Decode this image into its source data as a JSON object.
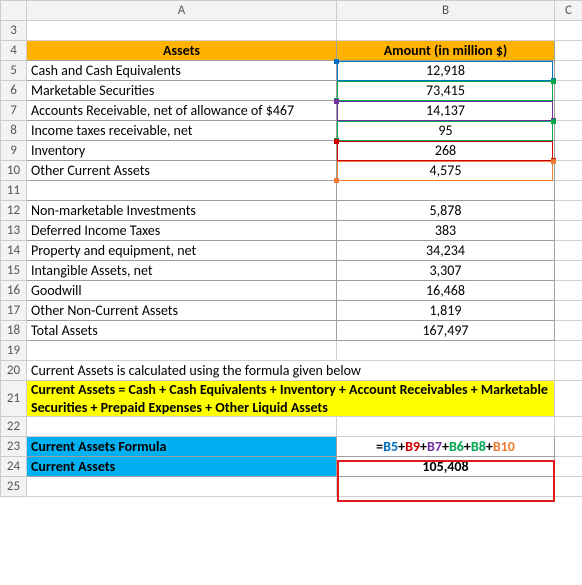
{
  "columns": {
    "A": "A",
    "B": "B",
    "C": "C"
  },
  "rows": [
    "3",
    "4",
    "5",
    "6",
    "7",
    "8",
    "9",
    "10",
    "11",
    "12",
    "13",
    "14",
    "15",
    "16",
    "17",
    "18",
    "19",
    "20",
    "21",
    "22",
    "23",
    "24",
    "25"
  ],
  "header": {
    "assets": "Assets",
    "amount": "Amount (in million $)"
  },
  "current_assets_rows": [
    {
      "label": "Cash and Cash Equivalents",
      "value": "12,918"
    },
    {
      "label": "Marketable Securities",
      "value": "73,415"
    },
    {
      "label": "Accounts Receivable, net of allowance of $467",
      "value": "14,137"
    },
    {
      "label": "Income taxes receivable, net",
      "value": "95"
    },
    {
      "label": "Inventory",
      "value": "268"
    },
    {
      "label": "Other Current Assets",
      "value": "4,575"
    }
  ],
  "noncurrent_rows": [
    {
      "label": "Non-marketable Investments",
      "value": "5,878"
    },
    {
      "label": "Deferred Income Taxes",
      "value": "383"
    },
    {
      "label": "Property and equipment, net",
      "value": "34,234"
    },
    {
      "label": "Intangible Assets, net",
      "value": "3,307"
    },
    {
      "label": "Goodwill",
      "value": "16,468"
    },
    {
      "label": "Other Non-Current Assets",
      "value": "1,819"
    },
    {
      "label": "Total Assets",
      "value": "167,497"
    }
  ],
  "note": "Current Assets is calculated using the formula given below",
  "formula_desc": "Current Assets = Cash + Cash Equivalents + Inventory + Account Receivables + Marketable Securities + Prepaid Expenses + Other Liquid Assets",
  "result_label": "Current Assets Formula",
  "result_label2": "Current Assets",
  "result_value": "105,408",
  "formula": {
    "eq": "=",
    "b5": "B5",
    "b9": "B9",
    "b7": "B7",
    "b6": "B6",
    "b8": "B8",
    "b10": "B10",
    "plus": "+"
  },
  "chart_data": {
    "type": "table",
    "title": "Assets — Amount (in million $)",
    "rows": [
      [
        "Cash and Cash Equivalents",
        12918
      ],
      [
        "Marketable Securities",
        73415
      ],
      [
        "Accounts Receivable, net of allowance of $467",
        14137
      ],
      [
        "Income taxes receivable, net",
        95
      ],
      [
        "Inventory",
        268
      ],
      [
        "Other Current Assets",
        4575
      ],
      [
        "Non-marketable Investments",
        5878
      ],
      [
        "Deferred Income Taxes",
        383
      ],
      [
        "Property and equipment, net",
        34234
      ],
      [
        "Intangible Assets, net",
        3307
      ],
      [
        "Goodwill",
        16468
      ],
      [
        "Other Non-Current Assets",
        1819
      ],
      [
        "Total Assets",
        167497
      ],
      [
        "Current Assets",
        105408
      ]
    ],
    "current_assets_formula": "=B5+B9+B7+B6+B8+B10"
  }
}
